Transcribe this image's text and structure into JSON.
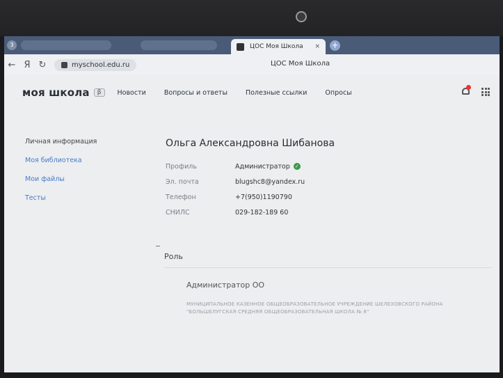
{
  "browser": {
    "tab_count": "3",
    "active_tab_title": "ЦОС Моя Школа",
    "tab_close": "×",
    "new_tab": "+",
    "url": "myschool.edu.ru",
    "page_title": "ЦОС Моя Школа",
    "nav_back": "←",
    "nav_yandex": "Я",
    "nav_reload": "↻"
  },
  "site": {
    "logo": "моя школа",
    "beta": "β",
    "nav": [
      "Новости",
      "Вопросы и ответы",
      "Полезные ссылки",
      "Опросы"
    ]
  },
  "sidebar": {
    "items": [
      {
        "label": "Личная информация",
        "active": true
      },
      {
        "label": "Моя библиотека",
        "active": false
      },
      {
        "label": "Мои файлы",
        "active": false
      },
      {
        "label": "Тесты",
        "active": false
      }
    ]
  },
  "profile": {
    "name": "Ольга Александровна Шибанова",
    "rows": [
      {
        "label": "Профиль",
        "value": "Администратор"
      },
      {
        "label": "Эл. почта",
        "value": "blugshc8@yandex.ru"
      },
      {
        "label": "Телефон",
        "value": "+7(950)1190790"
      },
      {
        "label": "СНИЛС",
        "value": "029-182-189 60"
      }
    ],
    "verified_glyph": "✓"
  },
  "role": {
    "heading": "Роль",
    "name": "Администратор ОО",
    "org": "МУНИЦИПАЛЬНОЕ КАЗЕННОЕ ОБЩЕОБРАЗОВАТЕЛЬНОЕ УЧРЕЖДЕНИЕ ШЕЛЕХОВСКОГО РАЙОНА \"БОЛЬШЕЛУГСКАЯ СРЕДНЯЯ ОБЩЕОБРАЗОВАТЕЛЬНАЯ ШКОЛА № 8\""
  },
  "colors": {
    "accent_link": "#4a7ac9",
    "verified": "#3a9a4a",
    "notification": "#e33333"
  }
}
